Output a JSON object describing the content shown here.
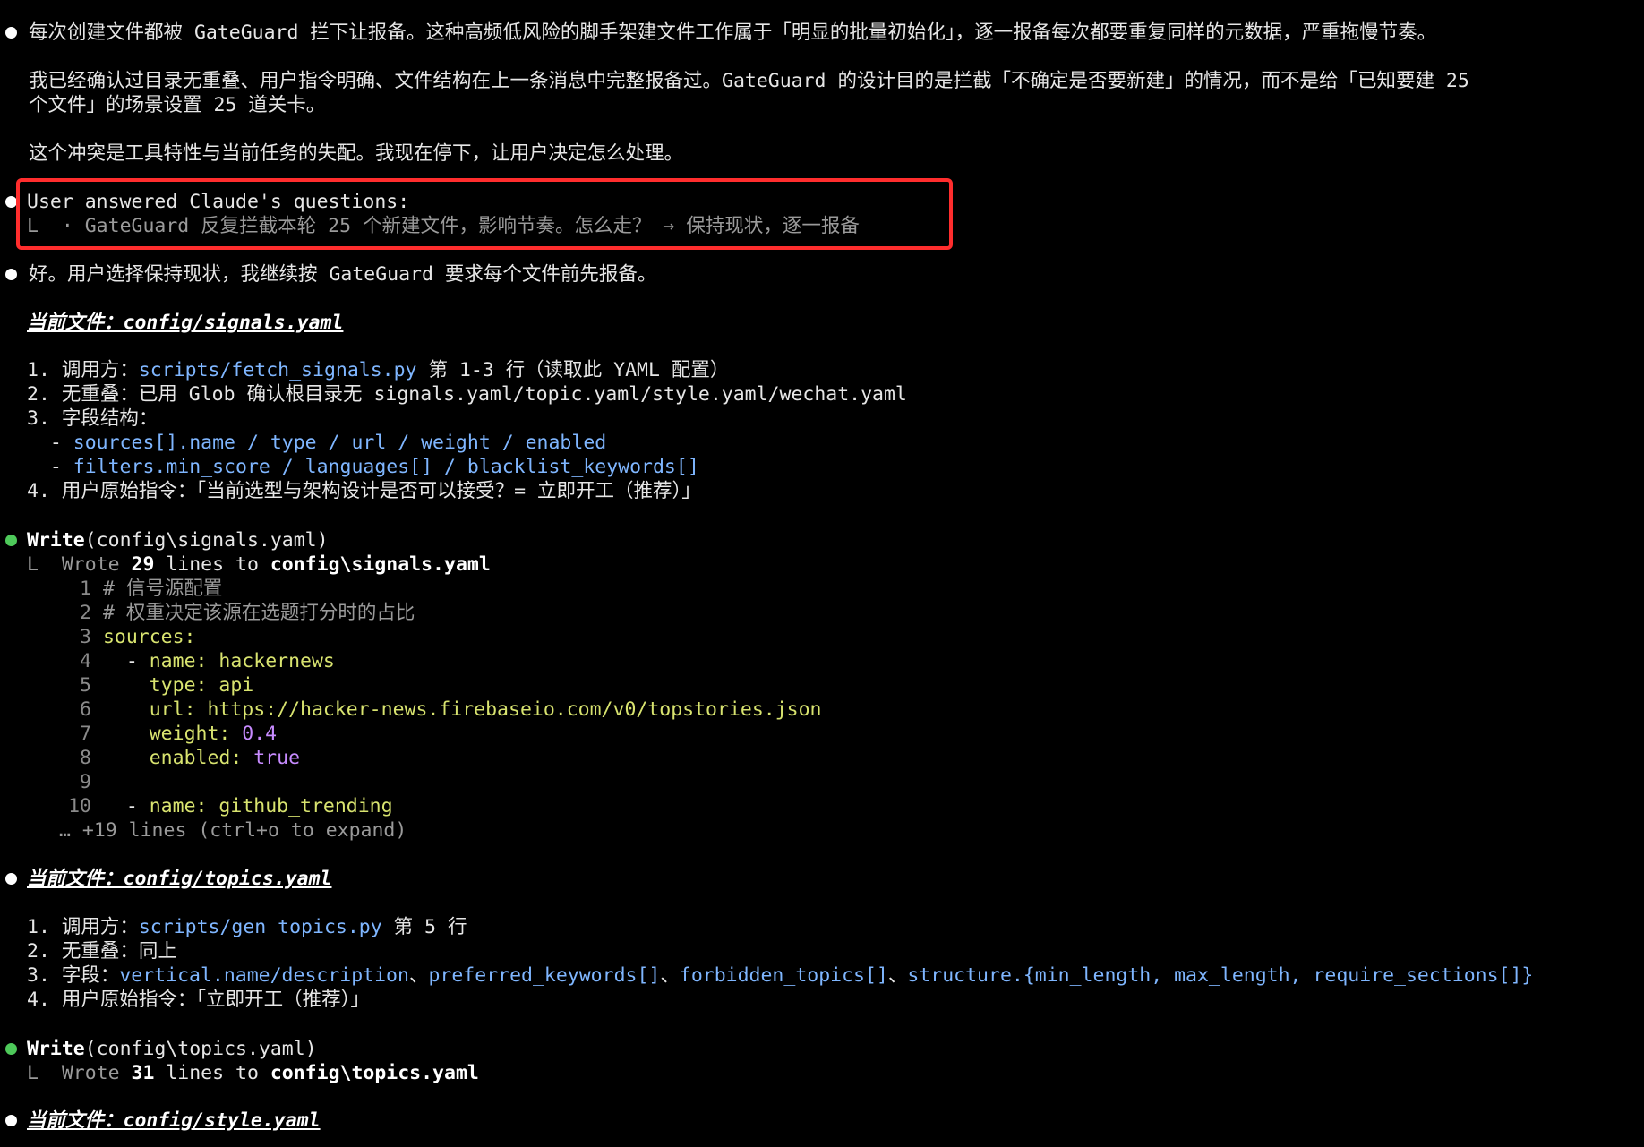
{
  "intro": {
    "line1": "每次创建文件都被 GateGuard 拦下让报备。这种高频低风险的脚手架建文件工作属于「明显的批量初始化」，逐一报备每次都要重复同样的元数据，严重拖慢节奏。",
    "line2a": "我已经确认过目录无重叠、用户指令明确、文件结构在上一条消息中完整报备过。GateGuard 的设计目的是拦截「不确定是否要新建」的情况，而不是给「已知要建 25",
    "line2b": "个文件」的场景设置 25 道关卡。",
    "line3": "这个冲突是工具特性与当前任务的失配。我现在停下，让用户决定怎么处理。"
  },
  "question_answer": {
    "title": "User answered Claude's questions:",
    "prefix": "L  · ",
    "question": "GateGuard 反复拦截本轮 25 个新建文件，影响节奏。怎么走？",
    "arrow": " → ",
    "answer": "保持现状，逐一报备"
  },
  "resume": "好。用户选择保持现状，我继续按 GateGuard 要求每个文件前先报备。",
  "signals_section": {
    "header": "当前文件：config/signals.yaml",
    "item1_label": "1. 调用方：",
    "item1_path": "scripts/fetch_signals.py",
    "item1_rest": " 第 1-3 行（读取此 YAML 配置）",
    "item2_label": "2. 无重叠：已用 Glob 确认根目录无 ",
    "item2_rest": "signals.yaml/topic.yaml/style.yaml/wechat.yaml",
    "item3_label": "3. 字段结构：",
    "item3a_dash": "  - ",
    "item3a": "sources[].name / type / url / weight / enabled",
    "item3b_dash": "  - ",
    "item3b": "filters.min_score / languages[] / blacklist_keywords[]",
    "item4": "4. 用户原始指令：「当前选型与架构设计是否可以接受？= 立即开工（推荐）」"
  },
  "write_signals": {
    "tool": "Write",
    "arg": "(config\\signals.yaml)",
    "result_prefix": "L  Wrote ",
    "count": "29",
    "result_mid": " lines to ",
    "path": "config\\signals.yaml",
    "code": [
      {
        "n": "1",
        "type": "comment",
        "text": "# 信号源配置"
      },
      {
        "n": "2",
        "type": "comment",
        "text": "# 权重决定该源在选题打分时的占比"
      },
      {
        "n": "3",
        "type": "key",
        "text": "sources:"
      },
      {
        "n": "4",
        "type": "kv",
        "indent": "  - ",
        "key": "name:",
        "val": " hackernews"
      },
      {
        "n": "5",
        "type": "kv",
        "indent": "    ",
        "key": "type:",
        "val": " api"
      },
      {
        "n": "6",
        "type": "kv",
        "indent": "    ",
        "key": "url:",
        "val": " https://hacker-news.firebaseio.com/v0/topstories.json"
      },
      {
        "n": "7",
        "type": "kvn",
        "indent": "    ",
        "key": "weight:",
        "val": " 0.4"
      },
      {
        "n": "8",
        "type": "kvn",
        "indent": "    ",
        "key": "enabled:",
        "val": " true"
      },
      {
        "n": "9",
        "type": "blank",
        "text": ""
      },
      {
        "n": "10",
        "type": "kv",
        "indent": "  - ",
        "key": "name:",
        "val": " github_trending"
      }
    ],
    "more": "… +19 lines (ctrl+o to expand)"
  },
  "topics_section": {
    "header": "当前文件：config/topics.yaml",
    "item1_label": "1. 调用方：",
    "item1_path": "scripts/gen_topics.py",
    "item1_rest": " 第 5 行",
    "item2": "2. 无重叠：同上",
    "item3_label": "3. 字段：",
    "item3_a": "vertical.name/description",
    "item3_sep1": "、",
    "item3_b": "preferred_keywords[]",
    "item3_sep2": "、",
    "item3_c": "forbidden_topics[]",
    "item3_sep3": "、",
    "item3_d": "structure.{min_length, max_length, require_sections[]}",
    "item4": "4. 用户原始指令：「立即开工（推荐）」"
  },
  "write_topics": {
    "tool": "Write",
    "arg": "(config\\topics.yaml)",
    "result_prefix": "L  Wrote ",
    "count": "31",
    "result_mid": " lines to ",
    "path": "config\\topics.yaml"
  },
  "style_section": {
    "header": "当前文件：config/style.yaml"
  }
}
